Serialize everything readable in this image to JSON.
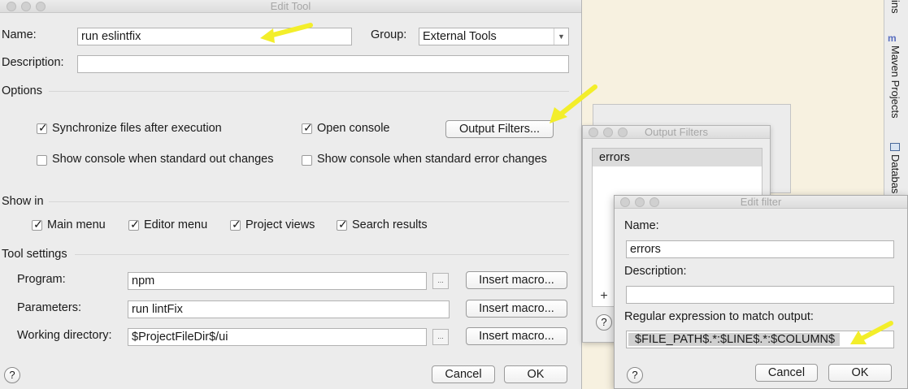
{
  "main": {
    "title": "Edit Tool",
    "name_label": "Name:",
    "name_value": "run eslintfix",
    "group_label": "Group:",
    "group_value": "External Tools",
    "description_label": "Description:",
    "description_value": "",
    "options_label": "Options",
    "sync_label": "Synchronize files after execution",
    "sync_checked": true,
    "open_console_label": "Open console",
    "open_console_checked": true,
    "output_filters_label": "Output Filters...",
    "show_stdout_label": "Show console when standard out changes",
    "show_stdout_checked": false,
    "show_stderr_label": "Show console when standard error changes",
    "show_stderr_checked": false,
    "show_in_label": "Show in",
    "main_menu_label": "Main menu",
    "editor_menu_label": "Editor menu",
    "project_views_label": "Project views",
    "search_results_label": "Search results",
    "tool_settings_label": "Tool settings",
    "program_label": "Program:",
    "program_value": "npm",
    "parameters_label": "Parameters:",
    "parameters_value": "run lintFix",
    "workdir_label": "Working directory:",
    "workdir_value": "$ProjectFileDir$/ui",
    "insert_macro_label": "Insert macro...",
    "browse_label": "...",
    "help_label": "?",
    "cancel_label": "Cancel",
    "ok_label": "OK"
  },
  "side": {
    "maven_label": "Maven Projects",
    "database_label": "Databas",
    "top_label": "ins"
  },
  "output_filters": {
    "title": "Output Filters",
    "items": [
      "errors"
    ],
    "add_label": "+",
    "help_label": "?"
  },
  "edit_filter": {
    "title": "Edit filter",
    "name_label": "Name:",
    "name_value": "errors",
    "description_label": "Description:",
    "description_value": "",
    "regex_label": "Regular expression to match output:",
    "regex_value": "$FILE_PATH$.*:$LINE$.*:$COLUMN$",
    "help_label": "?",
    "cancel_label": "Cancel",
    "ok_label": "OK"
  },
  "colors": {
    "annotation_arrow": "#f3ee2a",
    "window_bg": "#ececec",
    "background": "#f7f1e0"
  }
}
